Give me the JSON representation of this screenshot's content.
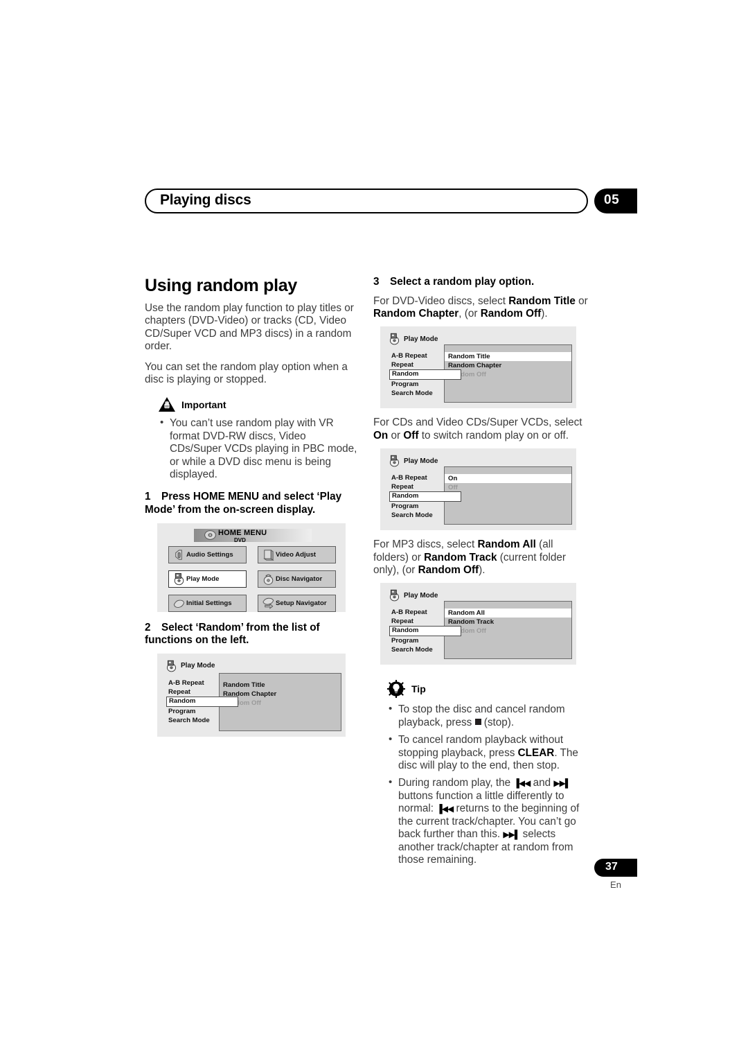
{
  "header": {
    "running_title": "Playing discs",
    "chapter_number": "05"
  },
  "left_column": {
    "section_title": "Using random play",
    "intro_1": "Use the random play function to play titles or chapters (DVD-Video) or tracks (CD,  Video CD/Super VCD and MP3 discs) in a random order.",
    "intro_2": "You can set the random play option when a disc is playing or stopped.",
    "important_label": "Important",
    "important_bullets": [
      "You can’t use random play with VR format DVD-RW discs, Video CDs/Super VCDs playing in PBC mode, or while a DVD disc menu is being displayed."
    ],
    "step1": {
      "number": "1",
      "text": "Press HOME MENU and select ‘Play Mode’ from the on-screen display."
    },
    "step2": {
      "number": "2",
      "text": "Select ‘Random’ from the list of functions on the left."
    }
  },
  "home_menu_figure": {
    "title": "HOME MENU",
    "subtitle": "DVD",
    "disc_icon": "disc-icon",
    "buttons": [
      {
        "label": "Audio Settings",
        "icon": "audio-settings-icon",
        "selected": false
      },
      {
        "label": "Video Adjust",
        "icon": "video-adjust-icon",
        "selected": false
      },
      {
        "label": "Play Mode",
        "icon": "play-mode-icon",
        "selected": true
      },
      {
        "label": "Disc Navigator",
        "icon": "disc-navigator-icon",
        "selected": false
      },
      {
        "label": "Initial Settings",
        "icon": "initial-settings-icon",
        "selected": false
      },
      {
        "label": "Setup Navigator",
        "icon": "setup-navigator-icon",
        "selected": false
      }
    ]
  },
  "play_mode_figures": {
    "header_label": "Play Mode",
    "function_list": [
      "A-B Repeat",
      "Repeat",
      "Random",
      "Program",
      "Search Mode"
    ],
    "current_function": "Random",
    "step2": {
      "options": [
        {
          "label": "Random Title",
          "state": "normal",
          "highlighted": false
        },
        {
          "label": "Random Chapter",
          "state": "normal",
          "highlighted": false
        },
        {
          "label": "Random Off",
          "state": "disabled",
          "highlighted": false
        }
      ]
    },
    "dvd_video": {
      "options": [
        {
          "label": "Random Title",
          "state": "normal",
          "highlighted": true
        },
        {
          "label": "Random Chapter",
          "state": "normal",
          "highlighted": false
        },
        {
          "label": "Random Off",
          "state": "disabled",
          "highlighted": false
        }
      ]
    },
    "cd_vcd": {
      "options": [
        {
          "label": "On",
          "state": "normal",
          "highlighted": true
        },
        {
          "label": "Off",
          "state": "disabled",
          "highlighted": false
        }
      ]
    },
    "mp3": {
      "options": [
        {
          "label": "Random All",
          "state": "normal",
          "highlighted": true
        },
        {
          "label": "Random Track",
          "state": "normal",
          "highlighted": false
        },
        {
          "label": "Random Off",
          "state": "disabled",
          "highlighted": false
        }
      ]
    }
  },
  "right_column": {
    "step3": {
      "number": "3",
      "text": "Select a random play option."
    },
    "step3_body_a": "For DVD-Video discs, select ",
    "step3_body_b": "Random Title",
    "step3_body_c": " or ",
    "step3_body_d": "Random Chapter",
    "step3_body_e": ", (or ",
    "step3_body_f": "Random Off",
    "step3_body_g": ").",
    "cd_text_a": "For CDs and Video CDs/Super VCDs, select ",
    "cd_text_b": "On",
    "cd_text_c": " or ",
    "cd_text_d": "Off",
    "cd_text_e": " to switch random play on or off.",
    "mp3_text_a": "For MP3 discs, select ",
    "mp3_text_b": "Random All",
    "mp3_text_c": " (all folders) or ",
    "mp3_text_d": "Random Track",
    "mp3_text_e": " (current folder only), (or ",
    "mp3_text_f": "Random Off",
    "mp3_text_g": ").",
    "tip_label": "Tip",
    "tip_1_a": "To stop the disc and cancel random playback, press ",
    "tip_1_b": " (stop).",
    "tip_2_a": "To cancel random playback without stopping playback, press ",
    "tip_2_b": "CLEAR",
    "tip_2_c": ". The disc will play to the end, then stop.",
    "tip_3_a": "During random play, the ",
    "tip_3_prev": "▐◀◀",
    "tip_3_b": " and ",
    "tip_3_next": "▶▶▌",
    "tip_3_c": " buttons function a little differently to normal: ",
    "tip_3_d": " returns to the beginning of the current track/chapter. You can’t go back further than this. ",
    "tip_3_e": " selects another track/chapter at random from those remaining."
  },
  "footer": {
    "page_number": "37",
    "language": "En"
  },
  "colors": {
    "ink": "#231f20",
    "body_gray": "#3b3b3b",
    "figure_bg": "#e9e9e9",
    "panel_gray": "#c3c3c3",
    "button_gray": "#c9c9c9",
    "disabled_text": "#9a9a9a"
  }
}
